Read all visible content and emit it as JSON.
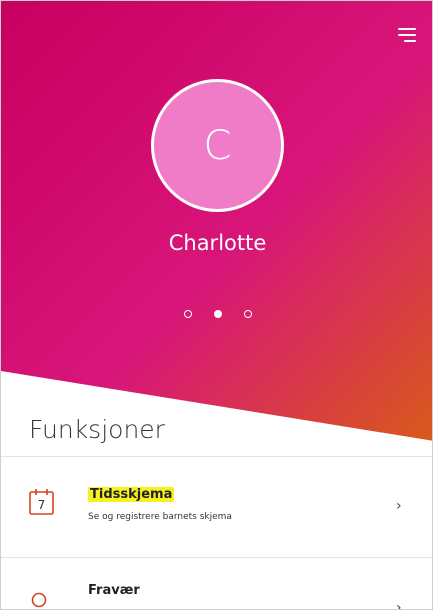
{
  "header": {
    "menu_icon": "hamburger-menu-icon"
  },
  "profile": {
    "initial": "C",
    "name": "Charlotte",
    "avatar_color": "#f07cc8"
  },
  "carousel": {
    "page_count": 3,
    "active_index": 1
  },
  "theme": {
    "gradient_top": "#c8005f",
    "gradient_mid": "#d8157a",
    "gradient_bottom_right": "#d85a1a"
  },
  "functions": {
    "title": "Funksjoner",
    "items": [
      {
        "title": "Tidsskjema",
        "description": "Se og registrere barnets skjema",
        "icon": "calendar-7-icon",
        "highlight_color": "#f7f21f"
      },
      {
        "title": "Fravær",
        "description": "",
        "icon": "absence-ring-icon"
      }
    ]
  },
  "chevron_glyph": "›"
}
